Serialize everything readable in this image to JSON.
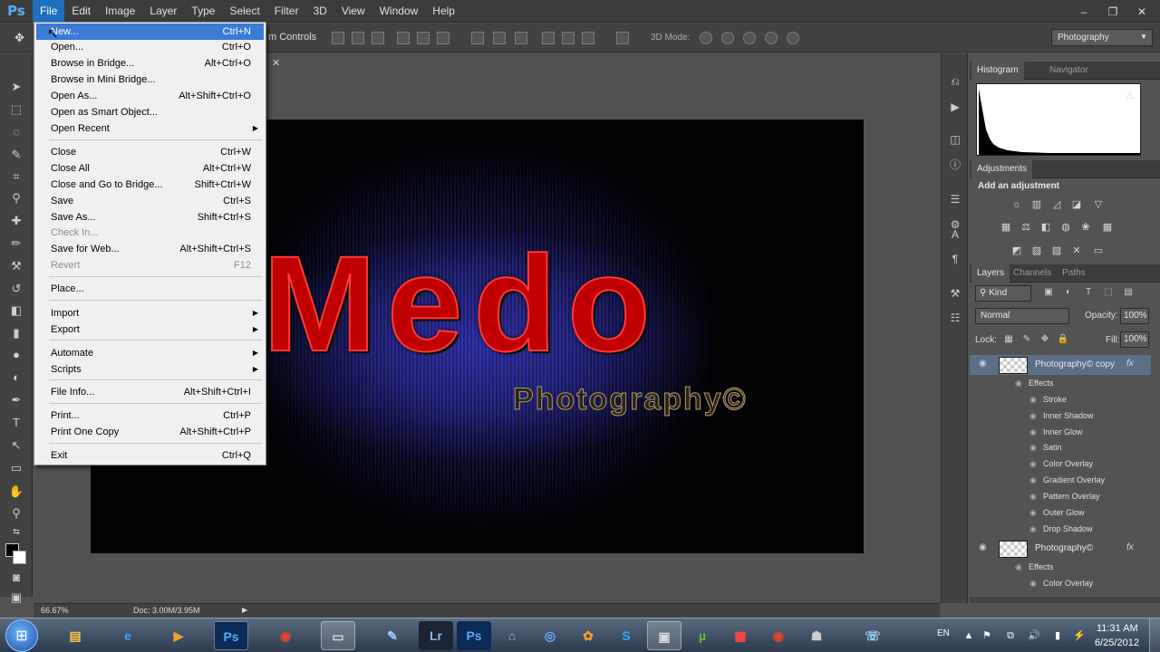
{
  "app": {
    "logo": "Ps"
  },
  "menubar": {
    "items": [
      "File",
      "Edit",
      "Image",
      "Layer",
      "Type",
      "Select",
      "Filter",
      "3D",
      "View",
      "Window",
      "Help"
    ],
    "active": "File"
  },
  "window_controls": {
    "minimize": "–",
    "restore": "❐",
    "close": "✕"
  },
  "options_bar": {
    "controls_label": "m Controls",
    "mode_label": "3D Mode:",
    "workspace": "Photography"
  },
  "document": {
    "tab_close": "✕",
    "title_text": "Medo",
    "subtitle_text": "Photography©"
  },
  "status_bar": {
    "zoom": "66.67%",
    "doc_size": "Doc: 3.00M/3.95M",
    "arrow": "▶"
  },
  "file_menu": {
    "items": [
      {
        "label": "New...",
        "shortcut": "Ctrl+N",
        "highlighted": true
      },
      {
        "label": "Open...",
        "shortcut": "Ctrl+O"
      },
      {
        "label": "Browse in Bridge...",
        "shortcut": "Alt+Ctrl+O"
      },
      {
        "label": "Browse in Mini Bridge...",
        "shortcut": ""
      },
      {
        "label": "Open As...",
        "shortcut": "Alt+Shift+Ctrl+O"
      },
      {
        "label": "Open as Smart Object...",
        "shortcut": ""
      },
      {
        "label": "Open Recent",
        "shortcut": "",
        "submenu": true
      },
      {
        "label": "Close",
        "shortcut": "Ctrl+W"
      },
      {
        "label": "Close All",
        "shortcut": "Alt+Ctrl+W"
      },
      {
        "label": "Close and Go to Bridge...",
        "shortcut": "Shift+Ctrl+W"
      },
      {
        "label": "Save",
        "shortcut": "Ctrl+S"
      },
      {
        "label": "Save As...",
        "shortcut": "Shift+Ctrl+S"
      },
      {
        "label": "Check In...",
        "shortcut": "",
        "disabled": true
      },
      {
        "label": "Save for Web...",
        "shortcut": "Alt+Shift+Ctrl+S"
      },
      {
        "label": "Revert",
        "shortcut": "F12",
        "disabled": true
      },
      {
        "label": "Place...",
        "shortcut": ""
      },
      {
        "label": "Import",
        "shortcut": "",
        "submenu": true
      },
      {
        "label": "Export",
        "shortcut": "",
        "submenu": true
      },
      {
        "label": "Automate",
        "shortcut": "",
        "submenu": true
      },
      {
        "label": "Scripts",
        "shortcut": "",
        "submenu": true
      },
      {
        "label": "File Info...",
        "shortcut": "Alt+Shift+Ctrl+I"
      },
      {
        "label": "Print...",
        "shortcut": "Ctrl+P"
      },
      {
        "label": "Print One Copy",
        "shortcut": "Alt+Shift+Ctrl+P"
      },
      {
        "label": "Exit",
        "shortcut": "Ctrl+Q"
      }
    ]
  },
  "panels": {
    "histogram_tabs": [
      "Histogram",
      "Navigator"
    ],
    "adjustments_tab": "Adjustments",
    "adjustments_title": "Add an adjustment",
    "layers_tabs": [
      "Layers",
      "Channels",
      "Paths"
    ],
    "filter_kind": "Kind",
    "blend_mode": "Normal",
    "opacity_label": "Opacity:",
    "opacity_value": "100%",
    "lock_label": "Lock:",
    "fill_label": "Fill:",
    "fill_value": "100%",
    "layers": [
      {
        "name": "Photography© copy",
        "effects_label": "Effects",
        "effects": [
          "Stroke",
          "Inner Shadow",
          "Inner Glow",
          "Satin",
          "Color Overlay",
          "Gradient Overlay",
          "Pattern Overlay",
          "Outer Glow",
          "Drop Shadow"
        ]
      },
      {
        "name": "Photography©",
        "effects_label": "Effects",
        "effects": [
          "Color Overlay"
        ]
      }
    ]
  },
  "taskbar": {
    "apps": [
      "Explorer",
      "Internet Explorer",
      "Media Player",
      "Photoshop",
      "Chrome",
      "Folder",
      "Tool"
    ],
    "pinned_right": [
      "Lr",
      "Ps"
    ],
    "lang": "EN",
    "time": "11:31 AM",
    "date": "6/25/2012"
  },
  "colors": {
    "accent": "#3a7bd5",
    "ps_blue": "#4fb0ff",
    "title_red": "#c00000"
  }
}
